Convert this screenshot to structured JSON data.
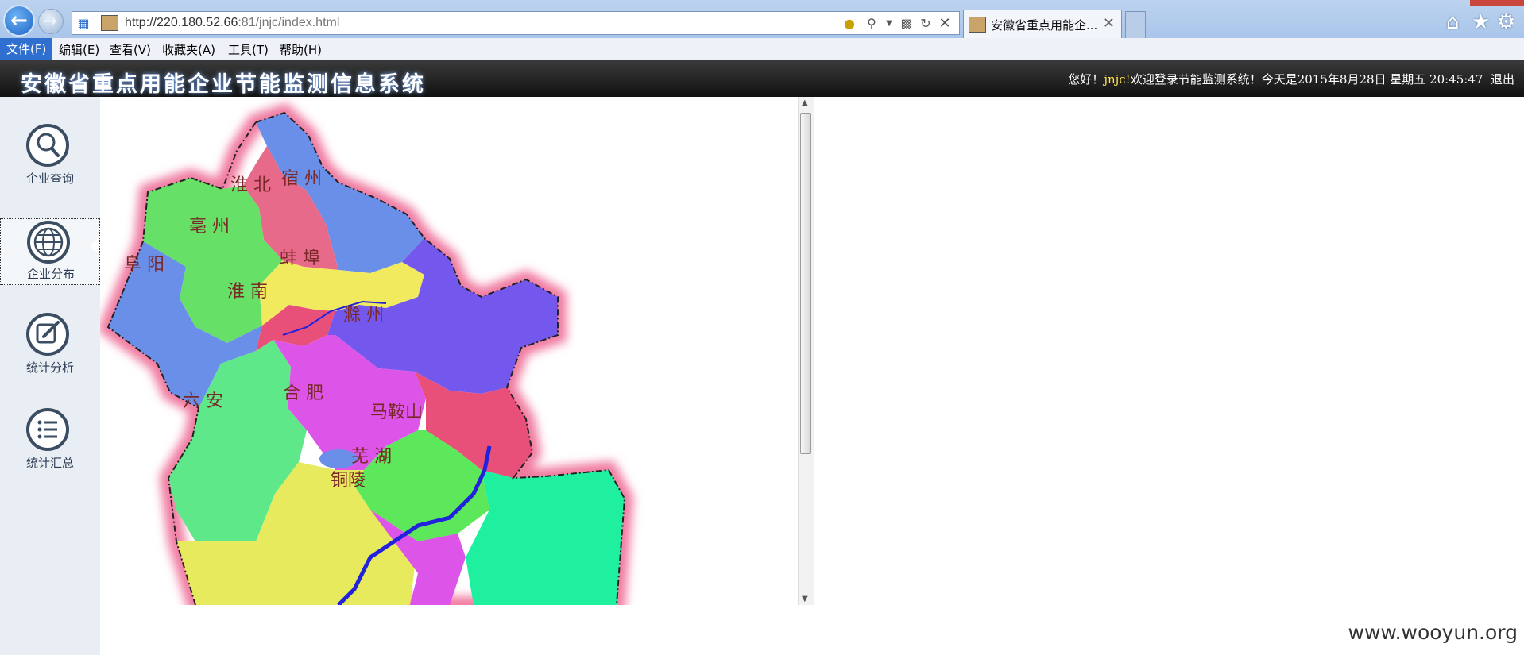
{
  "browser": {
    "url_main": "http://220.180.52.66",
    "url_rest": ":81/jnjc/index.html",
    "tab_title": "安徽省重点用能企...",
    "tab_close": "✕"
  },
  "menu": {
    "items": [
      {
        "label": "文件(F)"
      },
      {
        "label": "编辑(E)"
      },
      {
        "label": "查看(V)"
      },
      {
        "label": "收藏夹(A)"
      },
      {
        "label": "工具(T)"
      },
      {
        "label": "帮助(H)"
      }
    ]
  },
  "header": {
    "title": "安徽省重点用能企业节能监测信息系统",
    "greeting_prefix": "您好！",
    "username": "jnjc!",
    "greeting_suffix": "欢迎登录节能监测系统！今天是2015年8月28日 星期五 20:45:47",
    "logout": "退出"
  },
  "sidebar": {
    "items": [
      {
        "label": "企业查询",
        "icon": "search-icon"
      },
      {
        "label": "企业分布",
        "icon": "globe-icon"
      },
      {
        "label": "统计分析",
        "icon": "edit-icon"
      },
      {
        "label": "统计汇总",
        "icon": "list-icon"
      }
    ],
    "selected": "企业分布"
  },
  "map": {
    "cities": [
      "淮 北",
      "宿 州",
      "亳 州",
      "蚌 埠",
      "阜 阳",
      "淮 南",
      "滁 州",
      "六 安",
      "合 肥",
      "马鞍山",
      "芜 湖",
      "铜陵"
    ],
    "colors": {
      "glow": "#f07aa0",
      "blue": "#6a8fe8",
      "green": "#66e066",
      "pink": "#e86a8a",
      "yellow": "#f2ea5e",
      "red": "#e8507a",
      "violet": "#7458ee",
      "magenta": "#dd55e8",
      "mint": "#5ee88a",
      "lime": "#5ce85a",
      "teal": "#1ef0a0",
      "river": "#2222dd"
    }
  },
  "watermark": "www.wooyun.org"
}
